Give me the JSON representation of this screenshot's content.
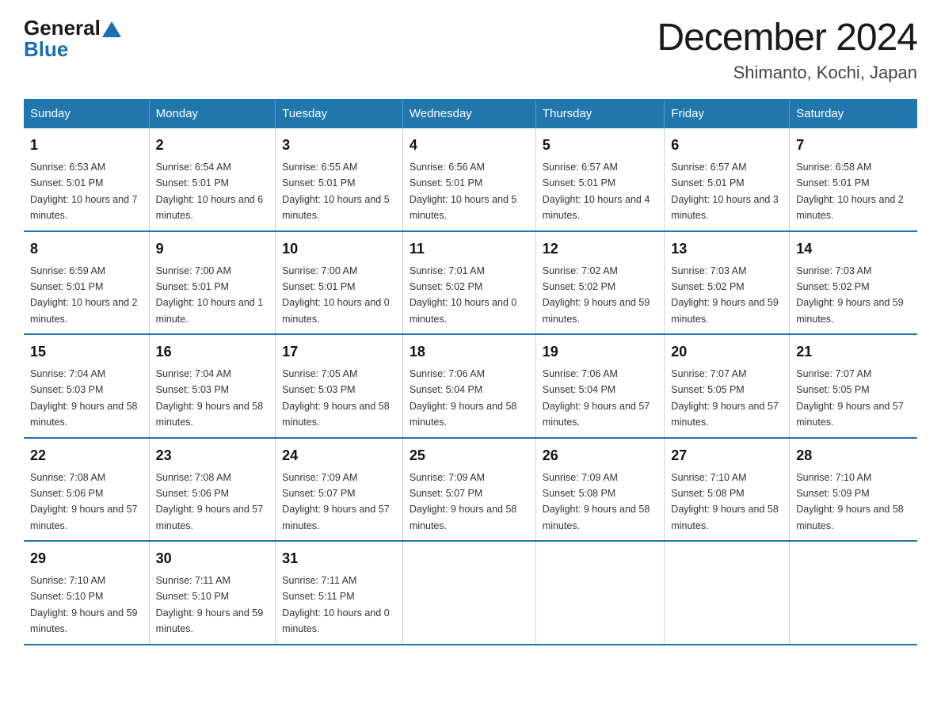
{
  "header": {
    "logo_general": "General",
    "logo_blue": "Blue",
    "month_title": "December 2024",
    "subtitle": "Shimanto, Kochi, Japan"
  },
  "days_of_week": [
    "Sunday",
    "Monday",
    "Tuesday",
    "Wednesday",
    "Thursday",
    "Friday",
    "Saturday"
  ],
  "weeks": [
    [
      {
        "day": "1",
        "sunrise": "6:53 AM",
        "sunset": "5:01 PM",
        "daylight": "10 hours and 7 minutes."
      },
      {
        "day": "2",
        "sunrise": "6:54 AM",
        "sunset": "5:01 PM",
        "daylight": "10 hours and 6 minutes."
      },
      {
        "day": "3",
        "sunrise": "6:55 AM",
        "sunset": "5:01 PM",
        "daylight": "10 hours and 5 minutes."
      },
      {
        "day": "4",
        "sunrise": "6:56 AM",
        "sunset": "5:01 PM",
        "daylight": "10 hours and 5 minutes."
      },
      {
        "day": "5",
        "sunrise": "6:57 AM",
        "sunset": "5:01 PM",
        "daylight": "10 hours and 4 minutes."
      },
      {
        "day": "6",
        "sunrise": "6:57 AM",
        "sunset": "5:01 PM",
        "daylight": "10 hours and 3 minutes."
      },
      {
        "day": "7",
        "sunrise": "6:58 AM",
        "sunset": "5:01 PM",
        "daylight": "10 hours and 2 minutes."
      }
    ],
    [
      {
        "day": "8",
        "sunrise": "6:59 AM",
        "sunset": "5:01 PM",
        "daylight": "10 hours and 2 minutes."
      },
      {
        "day": "9",
        "sunrise": "7:00 AM",
        "sunset": "5:01 PM",
        "daylight": "10 hours and 1 minute."
      },
      {
        "day": "10",
        "sunrise": "7:00 AM",
        "sunset": "5:01 PM",
        "daylight": "10 hours and 0 minutes."
      },
      {
        "day": "11",
        "sunrise": "7:01 AM",
        "sunset": "5:02 PM",
        "daylight": "10 hours and 0 minutes."
      },
      {
        "day": "12",
        "sunrise": "7:02 AM",
        "sunset": "5:02 PM",
        "daylight": "9 hours and 59 minutes."
      },
      {
        "day": "13",
        "sunrise": "7:03 AM",
        "sunset": "5:02 PM",
        "daylight": "9 hours and 59 minutes."
      },
      {
        "day": "14",
        "sunrise": "7:03 AM",
        "sunset": "5:02 PM",
        "daylight": "9 hours and 59 minutes."
      }
    ],
    [
      {
        "day": "15",
        "sunrise": "7:04 AM",
        "sunset": "5:03 PM",
        "daylight": "9 hours and 58 minutes."
      },
      {
        "day": "16",
        "sunrise": "7:04 AM",
        "sunset": "5:03 PM",
        "daylight": "9 hours and 58 minutes."
      },
      {
        "day": "17",
        "sunrise": "7:05 AM",
        "sunset": "5:03 PM",
        "daylight": "9 hours and 58 minutes."
      },
      {
        "day": "18",
        "sunrise": "7:06 AM",
        "sunset": "5:04 PM",
        "daylight": "9 hours and 58 minutes."
      },
      {
        "day": "19",
        "sunrise": "7:06 AM",
        "sunset": "5:04 PM",
        "daylight": "9 hours and 57 minutes."
      },
      {
        "day": "20",
        "sunrise": "7:07 AM",
        "sunset": "5:05 PM",
        "daylight": "9 hours and 57 minutes."
      },
      {
        "day": "21",
        "sunrise": "7:07 AM",
        "sunset": "5:05 PM",
        "daylight": "9 hours and 57 minutes."
      }
    ],
    [
      {
        "day": "22",
        "sunrise": "7:08 AM",
        "sunset": "5:06 PM",
        "daylight": "9 hours and 57 minutes."
      },
      {
        "day": "23",
        "sunrise": "7:08 AM",
        "sunset": "5:06 PM",
        "daylight": "9 hours and 57 minutes."
      },
      {
        "day": "24",
        "sunrise": "7:09 AM",
        "sunset": "5:07 PM",
        "daylight": "9 hours and 57 minutes."
      },
      {
        "day": "25",
        "sunrise": "7:09 AM",
        "sunset": "5:07 PM",
        "daylight": "9 hours and 58 minutes."
      },
      {
        "day": "26",
        "sunrise": "7:09 AM",
        "sunset": "5:08 PM",
        "daylight": "9 hours and 58 minutes."
      },
      {
        "day": "27",
        "sunrise": "7:10 AM",
        "sunset": "5:08 PM",
        "daylight": "9 hours and 58 minutes."
      },
      {
        "day": "28",
        "sunrise": "7:10 AM",
        "sunset": "5:09 PM",
        "daylight": "9 hours and 58 minutes."
      }
    ],
    [
      {
        "day": "29",
        "sunrise": "7:10 AM",
        "sunset": "5:10 PM",
        "daylight": "9 hours and 59 minutes."
      },
      {
        "day": "30",
        "sunrise": "7:11 AM",
        "sunset": "5:10 PM",
        "daylight": "9 hours and 59 minutes."
      },
      {
        "day": "31",
        "sunrise": "7:11 AM",
        "sunset": "5:11 PM",
        "daylight": "10 hours and 0 minutes."
      },
      null,
      null,
      null,
      null
    ]
  ]
}
